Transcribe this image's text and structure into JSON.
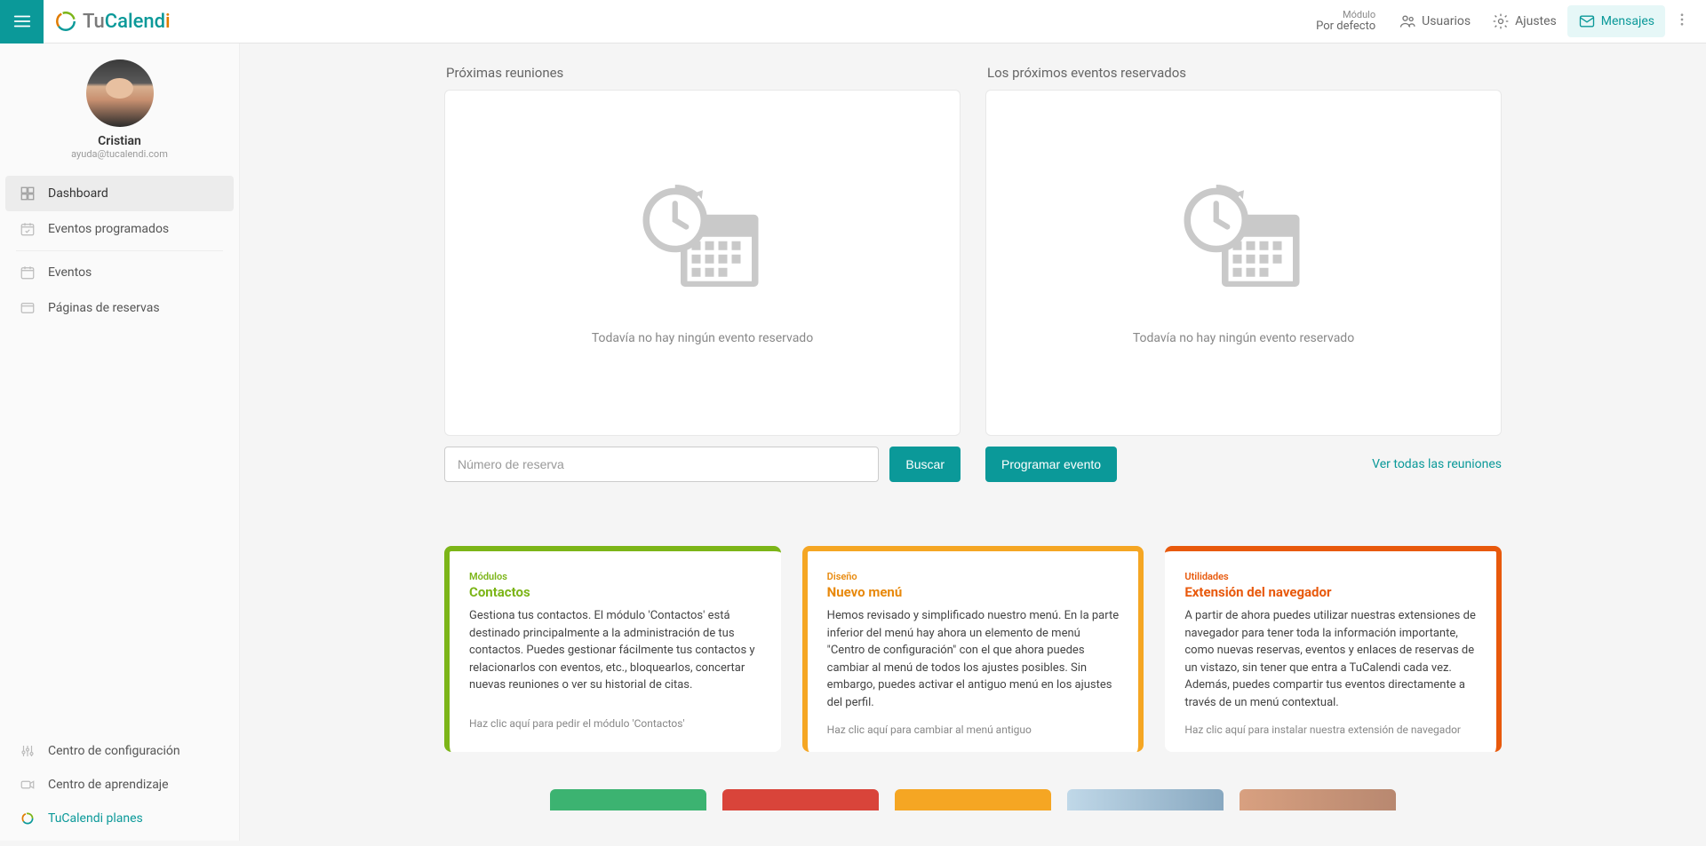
{
  "brand": {
    "tu": "Tu",
    "calend": "Calend",
    "i": "i"
  },
  "header": {
    "module_label": "Módulo",
    "module_value": "Por defecto",
    "users": "Usuarios",
    "settings": "Ajustes",
    "messages": "Mensajes"
  },
  "profile": {
    "name": "Cristian",
    "email": "ayuda@tucalendi.com"
  },
  "nav": {
    "dashboard": "Dashboard",
    "scheduled": "Eventos programados",
    "events": "Eventos",
    "booking_pages": "Páginas de reservas",
    "config_center": "Centro de configuración",
    "learning_center": "Centro de aprendizaje",
    "plans": "TuCalendi planes"
  },
  "dashboard": {
    "left_title": "Próximas reuniones",
    "right_title": "Los próximos eventos reservados",
    "empty_text": "Todavía no hay ningún evento reservado",
    "search_placeholder": "Número de reserva",
    "search_btn": "Buscar",
    "schedule_btn": "Programar evento",
    "view_all": "Ver todas las reuniones"
  },
  "info_cards": [
    {
      "category": "Módulos",
      "title": "Contactos",
      "body": "Gestiona tus contactos. El módulo 'Contactos' está destinado principalmente a la administración de tus contactos. Puedes gestionar fácilmente tus contactos y relacionarlos con eventos, etc., bloquearlos, concertar nuevas reuniones o ver su historial de citas.",
      "link": "Haz clic aquí para pedir el módulo 'Contactos'"
    },
    {
      "category": "Diseño",
      "title": "Nuevo menú",
      "body": "Hemos revisado y simplificado nuestro menú. En la parte inferior del menú hay ahora un elemento de menú \"Centro de configuración\" con el que ahora puedes cambiar al menú de todos los ajustes posibles. Sin embargo, puedes activar el antiguo menú en los ajustes del perfil.",
      "link": "Haz clic aquí para cambiar al menú antiguo"
    },
    {
      "category": "Utilidades",
      "title": "Extensión del navegador",
      "body": "A partir de ahora puedes utilizar nuestras extensiones de navegador para tener toda la información importante, como nuevas reservas, eventos y enlaces de reservas de un vistazo, sin tener que entra a TuCalendi cada vez. Además, puedes compartir tus eventos directamente a través de un menú contextual.",
      "link": "Haz clic aquí para instalar nuestra extensión de navegador"
    }
  ]
}
